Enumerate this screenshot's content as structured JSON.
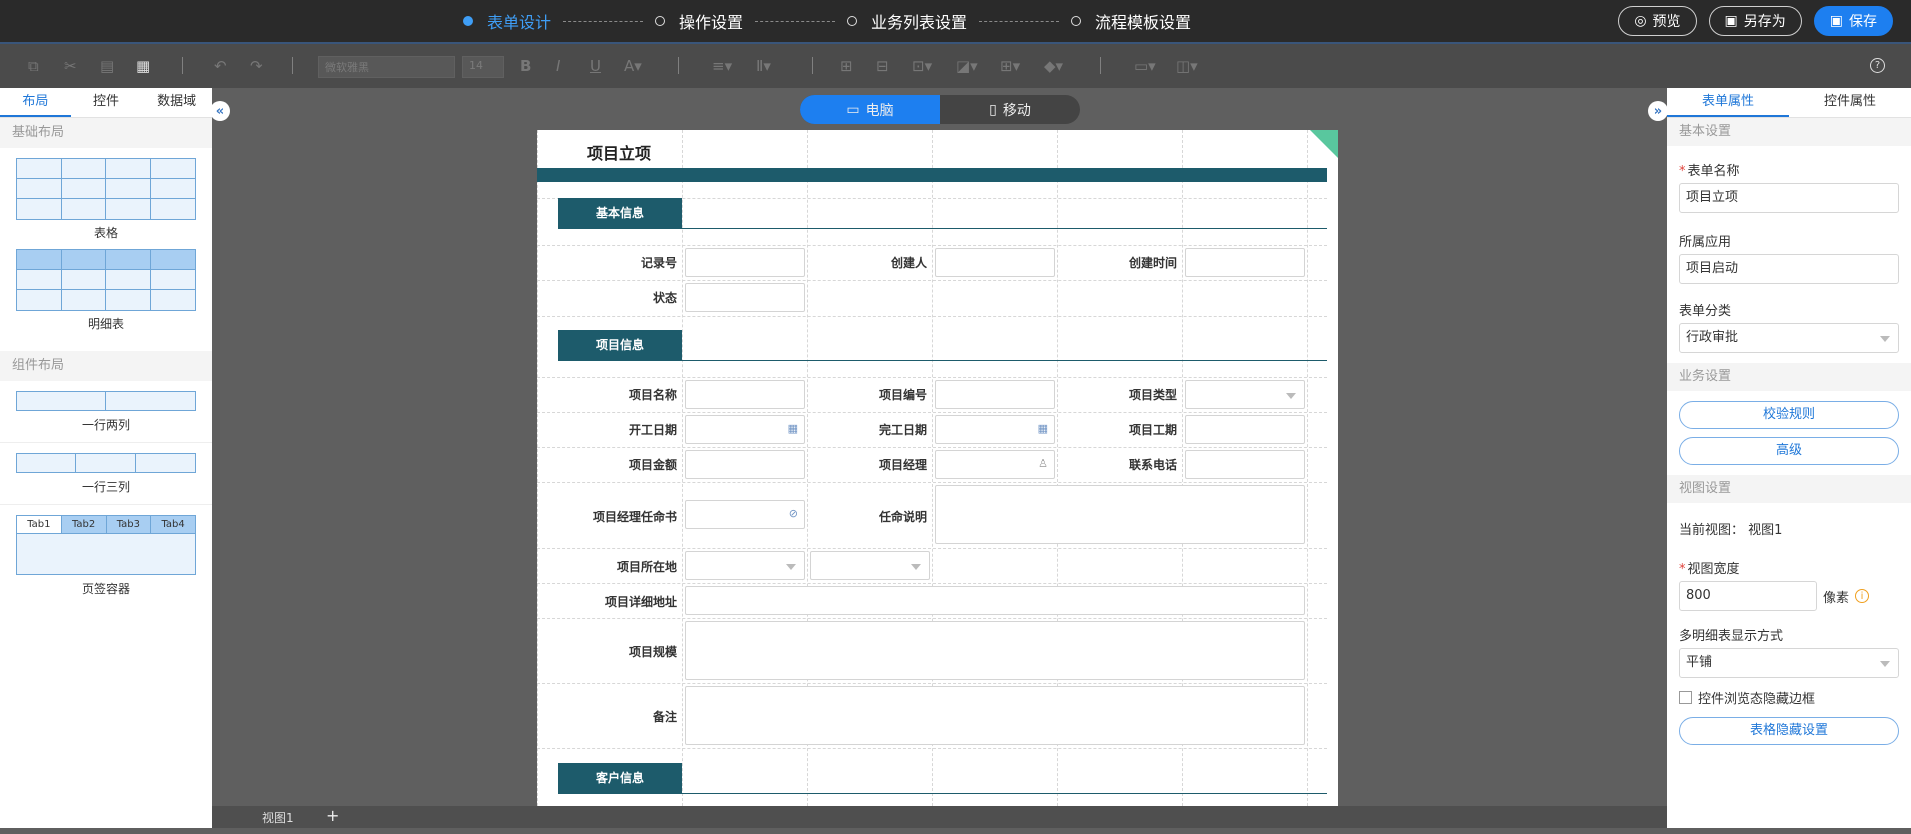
{
  "steps": [
    "表单设计",
    "操作设置",
    "业务列表设置",
    "流程模板设置"
  ],
  "top_buttons": {
    "preview": "预览",
    "save_as": "另存为",
    "save": "保存"
  },
  "toolbar": {
    "font_family": "微软雅黑",
    "font_size": "14",
    "help": "?"
  },
  "left_panel": {
    "tabs": [
      "布局",
      "控件",
      "数据域"
    ],
    "section_basic": "基础布局",
    "section_component": "组件布局",
    "table": "表格",
    "detail_table": "明细表",
    "two_col": "一行两列",
    "three_col": "一行三列",
    "tab_container": "页签容器",
    "tab_names": [
      "Tab1",
      "Tab2",
      "Tab3",
      "Tab4"
    ]
  },
  "device": {
    "pc": "电脑",
    "mobile": "移动"
  },
  "form": {
    "title": "项目立项",
    "sec_basic": "基本信息",
    "sec_project": "项目信息",
    "sec_customer": "客户信息",
    "labels": {
      "record_no": "记录号",
      "creator": "创建人",
      "create_time": "创建时间",
      "status": "状态",
      "project_name": "项目名称",
      "project_no": "项目编号",
      "project_type": "项目类型",
      "start_date": "开工日期",
      "end_date": "完工日期",
      "duration": "项目工期",
      "amount": "项目金额",
      "manager": "项目经理",
      "phone": "联系电话",
      "appointment": "项目经理任命书",
      "appoint_desc": "任命说明",
      "location": "项目所在地",
      "address": "项目详细地址",
      "scale": "项目规模",
      "remark": "备注"
    }
  },
  "bottom": {
    "view_tab": "视图1",
    "add": "+"
  },
  "right_panel": {
    "tabs": [
      "表单属性",
      "控件属性"
    ],
    "sect_basic": "基本设置",
    "form_name_label": "表单名称",
    "form_name": "项目立项",
    "app_label": "所属应用",
    "app": "项目启动",
    "category_label": "表单分类",
    "category": "行政审批",
    "sect_business": "业务设置",
    "validate_btn": "校验规则",
    "advanced_btn": "高级",
    "sect_view": "视图设置",
    "current_view_label": "当前视图：",
    "current_view": "视图1",
    "view_width_label": "视图宽度",
    "view_width": "800",
    "unit": "像素",
    "multi_detail_label": "多明细表显示方式",
    "multi_detail": "平铺",
    "hide_border": "控件浏览态隐藏边框",
    "table_hide_btn": "表格隐藏设置"
  }
}
